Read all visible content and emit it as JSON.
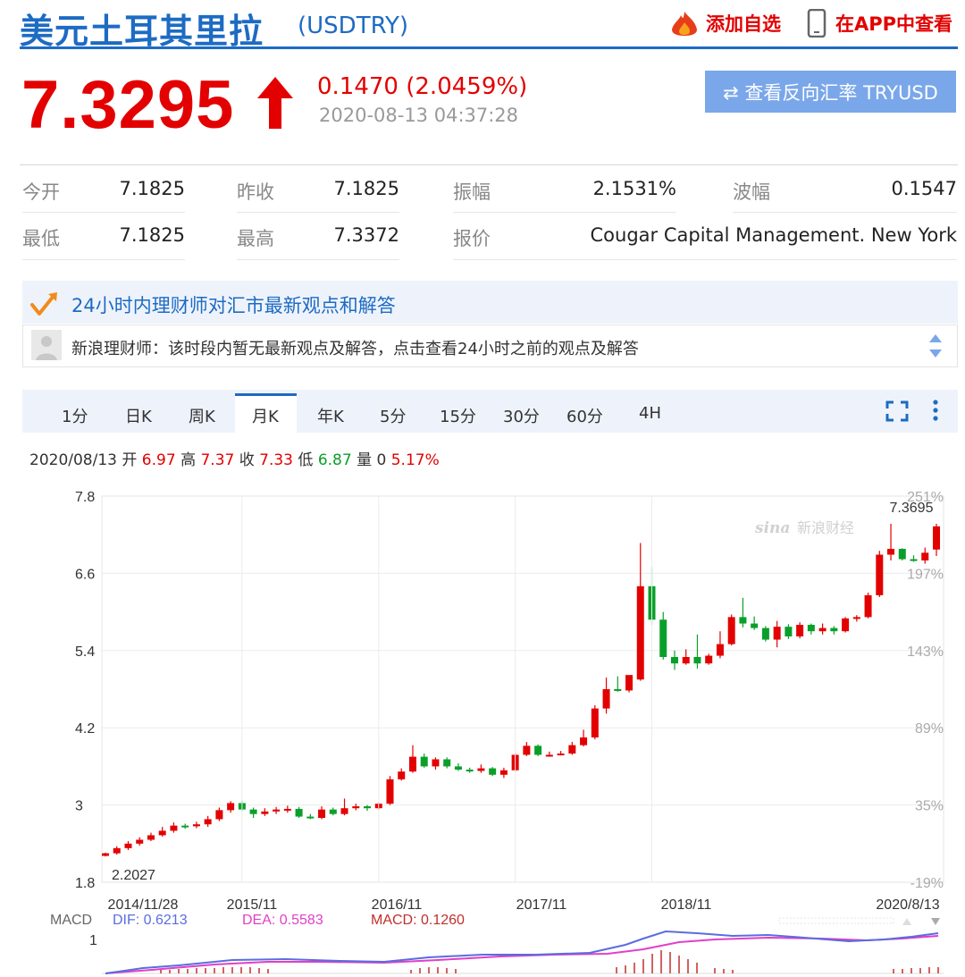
{
  "header": {
    "title": "美元土耳其里拉",
    "code": "(USDTRY)",
    "add_favorite": "添加自选",
    "view_in_app": "在APP中查看"
  },
  "quote": {
    "price": "7.3295",
    "change": "0.1470 (2.0459%)",
    "time": "2020-08-13 04:37:28",
    "inverse_button": "⇄ 查看反向汇率 TRYUSD",
    "direction": "up",
    "color_up": "#e30000",
    "color_down": "#0a9f2a"
  },
  "stats": [
    {
      "label": "今开",
      "value": "7.1825"
    },
    {
      "label": "昨收",
      "value": "7.1825"
    },
    {
      "label": "振幅",
      "value": "2.1531%"
    },
    {
      "label": "波幅",
      "value": "0.1547"
    },
    {
      "label": "最低",
      "value": "7.1825"
    },
    {
      "label": "最高",
      "value": "7.3372"
    },
    {
      "label": "报价",
      "value": "Cougar Capital Management. New York"
    }
  ],
  "news": {
    "title": "24小时内理财师对汇市最新观点和解答",
    "message": "新浪理财师：该时段内暂无最新观点及解答，点击查看24小时之前的观点及解答"
  },
  "tabs": [
    "1分",
    "日K",
    "周K",
    "月K",
    "年K",
    "5分",
    "15分",
    "30分",
    "60分",
    "4H"
  ],
  "active_tab": "月K",
  "ohlc": {
    "date": "2020/08/13",
    "open_label": "开",
    "open": "6.97",
    "high_label": "高",
    "high": "7.37",
    "close_label": "收",
    "close": "7.33",
    "low_label": "低",
    "low": "6.87",
    "volume_label": "量",
    "volume": "0",
    "change_pct": "5.17%"
  },
  "chart_data": [
    {
      "type": "candlestick",
      "y_ticks": [
        "7.8",
        "6.6",
        "5.4",
        "4.2",
        "3",
        "1.8"
      ],
      "y_right_ticks": [
        "251%",
        "197%",
        "143%",
        "89%",
        "35%",
        "-19%"
      ],
      "ylim": [
        1.8,
        7.8
      ],
      "x_tick_labels": [
        "2014/11/28",
        "2015/11",
        "2016/11",
        "2017/11",
        "2018/11",
        "2020/8/13"
      ],
      "max_label": "7.3695",
      "min_label": "2.2027",
      "watermark": "新浪财经",
      "candles": [
        [
          2.21,
          2.25,
          2.2,
          2.26
        ],
        [
          2.25,
          2.33,
          2.23,
          2.36
        ],
        [
          2.33,
          2.4,
          2.3,
          2.44
        ],
        [
          2.4,
          2.46,
          2.37,
          2.5
        ],
        [
          2.46,
          2.53,
          2.44,
          2.57
        ],
        [
          2.53,
          2.6,
          2.51,
          2.66
        ],
        [
          2.6,
          2.68,
          2.57,
          2.73
        ],
        [
          2.68,
          2.67,
          2.63,
          2.71
        ],
        [
          2.67,
          2.7,
          2.64,
          2.74
        ],
        [
          2.7,
          2.78,
          2.66,
          2.83
        ],
        [
          2.78,
          2.92,
          2.75,
          2.96
        ],
        [
          2.92,
          3.03,
          2.88,
          3.06
        ],
        [
          3.03,
          2.93,
          2.9,
          3.07
        ],
        [
          2.93,
          2.86,
          2.8,
          2.96
        ],
        [
          2.86,
          2.9,
          2.83,
          2.95
        ],
        [
          2.9,
          2.93,
          2.86,
          2.97
        ],
        [
          2.93,
          2.94,
          2.88,
          2.99
        ],
        [
          2.94,
          2.82,
          2.8,
          2.97
        ],
        [
          2.82,
          2.8,
          2.78,
          2.86
        ],
        [
          2.8,
          2.93,
          2.78,
          2.98
        ],
        [
          2.93,
          2.86,
          2.84,
          2.96
        ],
        [
          2.86,
          2.95,
          2.84,
          3.1
        ],
        [
          2.95,
          2.98,
          2.92,
          3.02
        ],
        [
          2.98,
          2.95,
          2.91,
          3.0
        ],
        [
          2.95,
          3.02,
          2.93,
          3.04
        ],
        [
          3.02,
          3.4,
          3.0,
          3.45
        ],
        [
          3.4,
          3.52,
          3.38,
          3.57
        ],
        [
          3.52,
          3.75,
          3.5,
          3.93
        ],
        [
          3.75,
          3.6,
          3.58,
          3.8
        ],
        [
          3.6,
          3.71,
          3.55,
          3.74
        ],
        [
          3.71,
          3.6,
          3.57,
          3.74
        ],
        [
          3.6,
          3.55,
          3.53,
          3.65
        ],
        [
          3.55,
          3.53,
          3.5,
          3.58
        ],
        [
          3.53,
          3.57,
          3.5,
          3.63
        ],
        [
          3.57,
          3.47,
          3.45,
          3.59
        ],
        [
          3.47,
          3.54,
          3.42,
          3.58
        ],
        [
          3.54,
          3.78,
          3.52,
          3.81
        ],
        [
          3.78,
          3.92,
          3.76,
          3.98
        ],
        [
          3.92,
          3.78,
          3.76,
          3.94
        ],
        [
          3.78,
          3.78,
          3.75,
          3.83
        ],
        [
          3.78,
          3.8,
          3.77,
          3.84
        ],
        [
          3.8,
          3.93,
          3.78,
          3.98
        ],
        [
          3.93,
          4.05,
          3.91,
          4.17
        ],
        [
          4.05,
          4.5,
          4.02,
          4.55
        ],
        [
          4.5,
          4.8,
          4.42,
          4.98
        ],
        [
          4.8,
          4.78,
          4.76,
          5.0
        ],
        [
          4.78,
          5.02,
          4.75,
          5.0
        ],
        [
          4.95,
          6.4,
          4.93,
          7.07
        ],
        [
          6.4,
          5.88,
          5.8,
          6.7
        ],
        [
          5.88,
          5.3,
          5.26,
          6.0
        ],
        [
          5.3,
          5.2,
          5.1,
          5.4
        ],
        [
          5.2,
          5.3,
          5.18,
          5.42
        ],
        [
          5.3,
          5.2,
          5.12,
          5.65
        ],
        [
          5.2,
          5.32,
          5.18,
          5.35
        ],
        [
          5.32,
          5.5,
          5.28,
          5.7
        ],
        [
          5.5,
          5.92,
          5.48,
          5.96
        ],
        [
          5.92,
          5.82,
          5.76,
          6.22
        ],
        [
          5.82,
          5.75,
          5.72,
          5.93
        ],
        [
          5.75,
          5.57,
          5.54,
          5.78
        ],
        [
          5.57,
          5.77,
          5.45,
          5.86
        ],
        [
          5.77,
          5.62,
          5.58,
          5.81
        ],
        [
          5.62,
          5.8,
          5.59,
          5.84
        ],
        [
          5.8,
          5.7,
          5.65,
          5.82
        ],
        [
          5.7,
          5.75,
          5.65,
          5.82
        ],
        [
          5.75,
          5.7,
          5.65,
          5.78
        ],
        [
          5.7,
          5.9,
          5.68,
          5.92
        ],
        [
          5.9,
          5.92,
          5.85,
          5.95
        ],
        [
          5.92,
          6.26,
          5.9,
          6.3
        ],
        [
          6.26,
          6.89,
          6.23,
          6.95
        ],
        [
          6.89,
          6.98,
          6.8,
          7.37
        ],
        [
          6.98,
          6.82,
          6.8,
          6.99
        ],
        [
          6.82,
          6.8,
          6.78,
          6.88
        ],
        [
          6.8,
          6.92,
          6.75,
          7.0
        ],
        [
          6.97,
          7.33,
          6.87,
          7.37
        ]
      ],
      "macd": {
        "label": "MACD",
        "dif": "DIF: 0.6213",
        "dea": "DEA: 0.5583",
        "macd": "MACD: 0.1260",
        "axis_tick": "1",
        "dif_color": "#5a6dde",
        "dea_color": "#e040c8",
        "bar_color": "#c0302a"
      }
    }
  ]
}
